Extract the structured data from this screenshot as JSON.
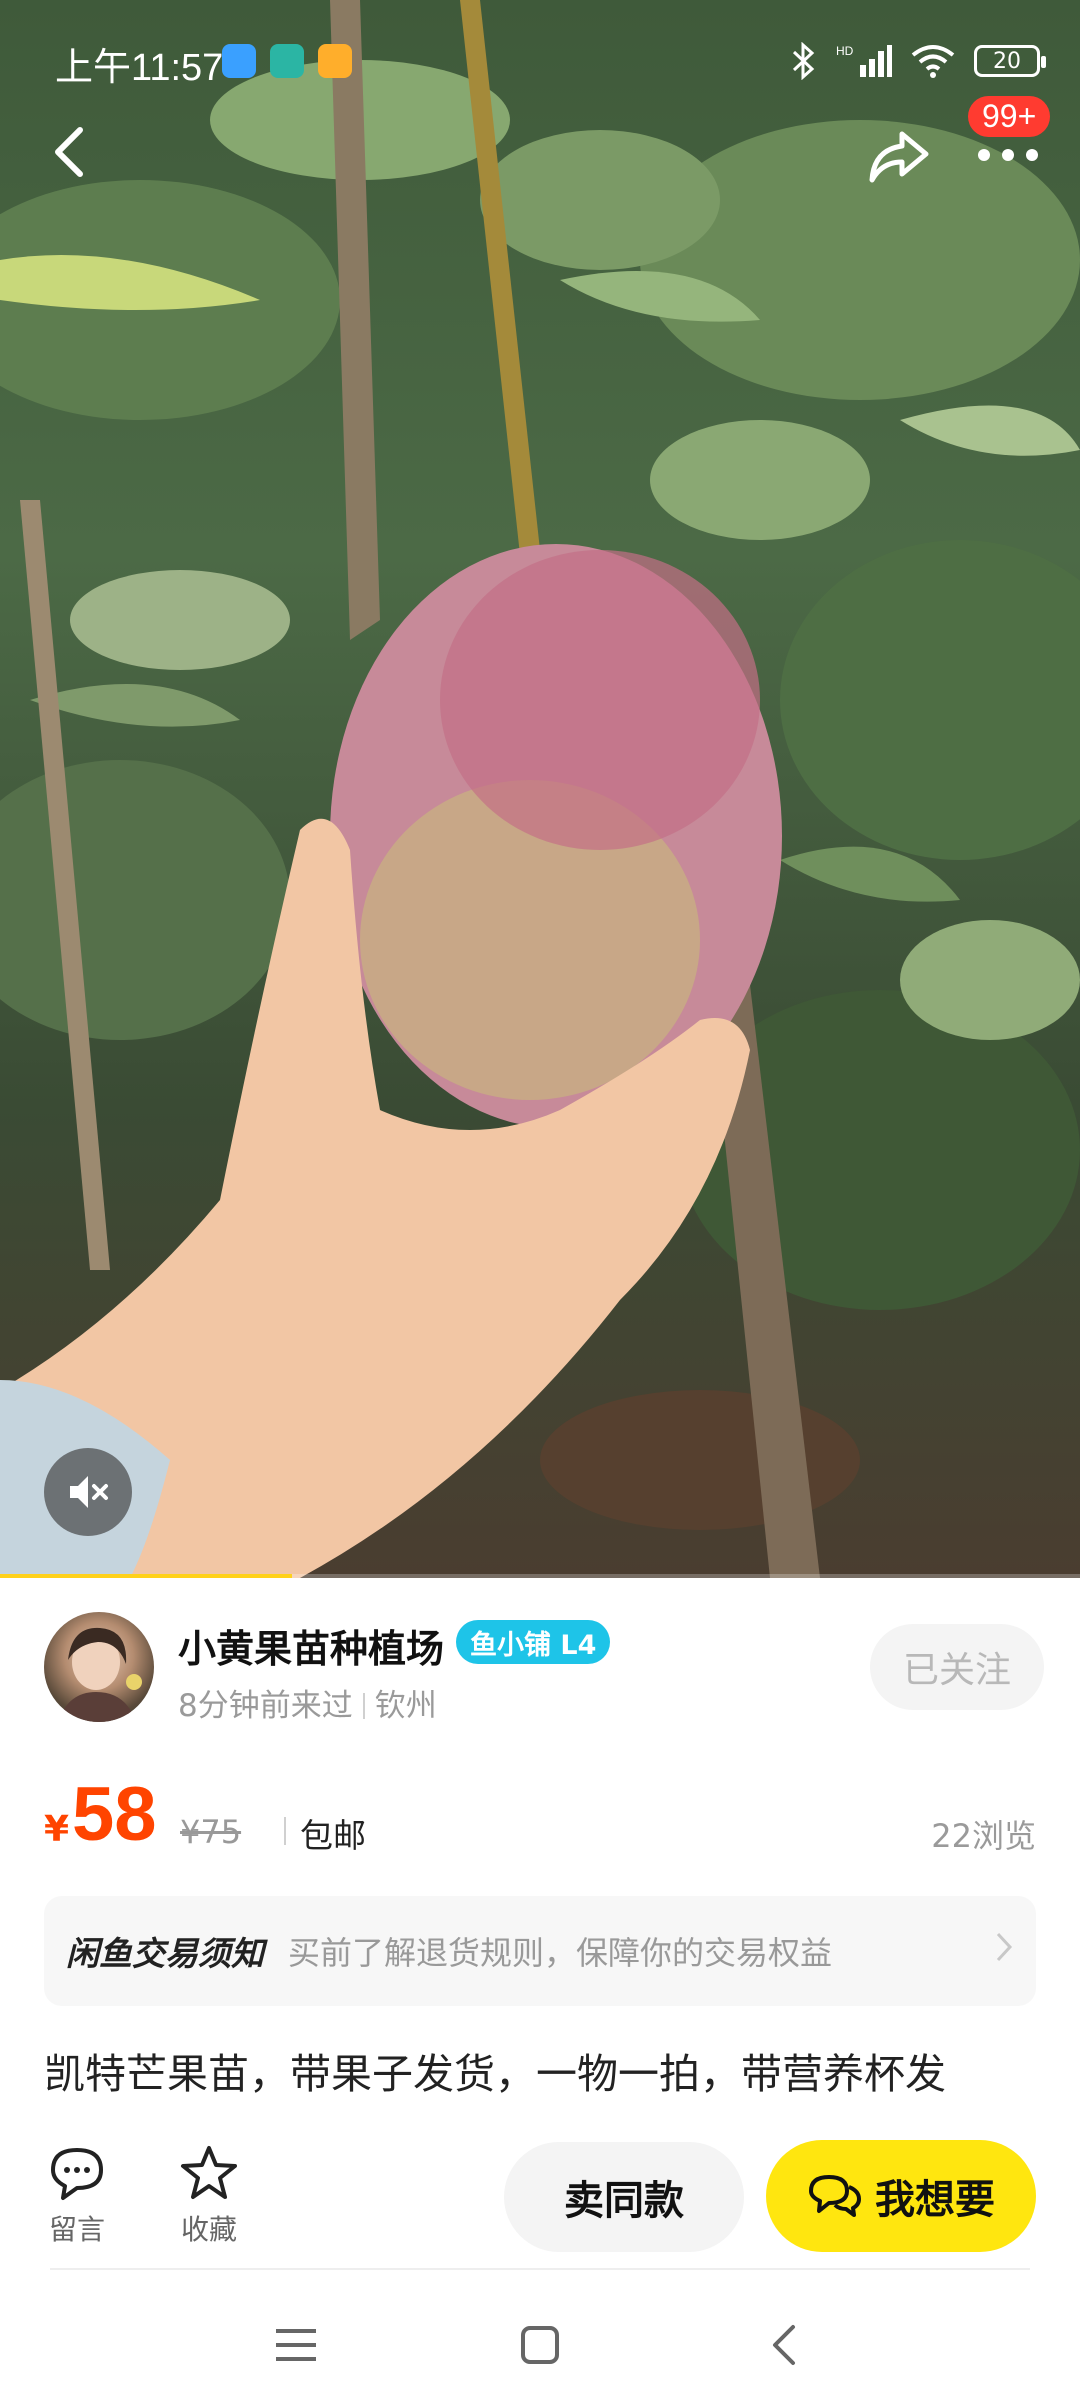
{
  "status_bar": {
    "time": "上午11:57",
    "battery": "20"
  },
  "header": {
    "notification_badge": "99+"
  },
  "media": {
    "progress_fraction": 0.27
  },
  "seller": {
    "name": "小黄果苗种植场",
    "badge": "鱼小铺 L4",
    "last_seen": "8分钟前来过",
    "location": "钦州",
    "follow_label": "已关注"
  },
  "price": {
    "currency": "¥",
    "current": "58",
    "original": "¥75",
    "shipping": "包邮",
    "views": "22浏览"
  },
  "notice": {
    "title": "闲鱼交易须知",
    "text": "买前了解退货规则，保障你的交易权益"
  },
  "description": "凯特芒果苗，带果子发货，一物一拍，带营养杯发",
  "actions": {
    "comment_label": "留言",
    "favorite_label": "收藏",
    "sell_same_label": "卖同款",
    "want_label": "我想要"
  },
  "colors": {
    "accent_yellow": "#ffe60f",
    "price_orange": "#ff4400",
    "badge_red": "#ff3b30",
    "shop_badge_blue": "#1ec4e8"
  }
}
